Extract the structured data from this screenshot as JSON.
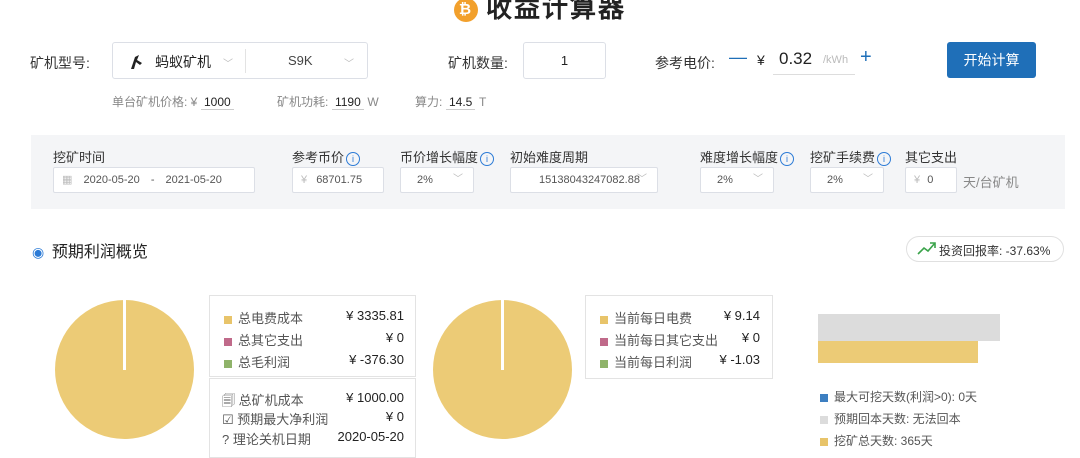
{
  "header": {
    "title": "收益计算器",
    "coin_glyph": "₿"
  },
  "miner": {
    "model_label": "矿机型号:",
    "brand": "蚂蚁矿机",
    "model": "S9K",
    "count_label": "矿机数量:",
    "count": "1",
    "price_label": "参考电价:",
    "minus": "—",
    "currency": "¥",
    "price": "0.32",
    "price_unit": "/kWh",
    "plus": "+",
    "calc_button": "开始计算",
    "unit_price_label": "单台矿机价格: ¥",
    "unit_price": "1000",
    "power_label": "矿机功耗:",
    "power": "1190",
    "power_unit": "W",
    "hash_label": "算力:",
    "hash": "14.5",
    "hash_unit": "T"
  },
  "params": {
    "mining_time_label": "挖矿时间",
    "date_start": "2020-05-20",
    "date_sep": "-",
    "date_end": "2021-05-20",
    "coin_price_label": "参考币价",
    "coin_price_currency": "¥",
    "coin_price": "68701.75",
    "price_growth_label": "币价增长幅度",
    "price_growth": "2%",
    "init_diff_label": "初始难度周期",
    "init_diff": "15138043247082.88",
    "diff_growth_label": "难度增长幅度",
    "diff_growth": "2%",
    "fee_label": "挖矿手续费",
    "fee": "2%",
    "other_label": "其它支出",
    "other_currency": "¥",
    "other": "0",
    "other_unit": "天/台矿机"
  },
  "overview": {
    "title": "预期利润概览",
    "roi": "投资回报率: -37.63%",
    "legend1": [
      {
        "label": "总电费成本",
        "value": "¥ 3335.81",
        "color": "#e8c46a"
      },
      {
        "label": "总其它支出",
        "value": "¥ 0",
        "color": "#c06a8a"
      },
      {
        "label": "总毛利润",
        "value": "¥ -376.30",
        "color": "#8fb36a"
      }
    ],
    "summary": [
      {
        "label": "总矿机成本",
        "value": "¥ 1000.00"
      },
      {
        "label": "预期最大净利润",
        "value": "¥ 0"
      },
      {
        "label": "理论关机日期",
        "value": "2020-05-20"
      }
    ],
    "legend2": [
      {
        "label": "当前每日电费",
        "value": "¥ 9.14",
        "color": "#e8c46a"
      },
      {
        "label": "当前每日其它支出",
        "value": "¥ 0",
        "color": "#c06a8a"
      },
      {
        "label": "当前每日利润",
        "value": "¥ -1.03",
        "color": "#8fb36a"
      }
    ],
    "days": [
      {
        "label": "最大可挖天数(利润>0): 0天",
        "color": "#3d7fc1"
      },
      {
        "label": "预期回本天数: 无法回本",
        "color": "#dcdcdc"
      },
      {
        "label": "挖矿总天数: 365天",
        "color": "#e8c46a"
      }
    ],
    "pie_color": "#eccb76"
  }
}
